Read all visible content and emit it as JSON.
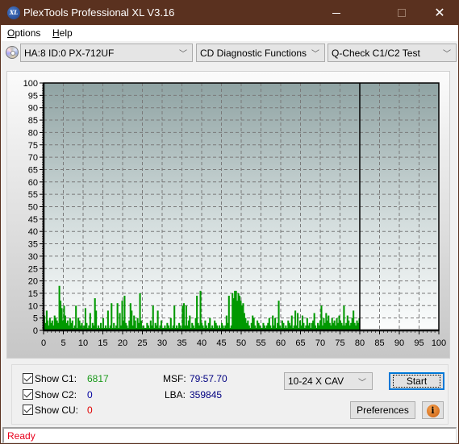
{
  "window": {
    "title": "PlexTools Professional XL V3.16",
    "icon_text": "XL"
  },
  "menu": {
    "items": [
      {
        "label": "Options",
        "mnemonic": "O"
      },
      {
        "label": "Help",
        "mnemonic": "H"
      }
    ]
  },
  "toolbar": {
    "drive": "HA:8 ID:0  PX-712UF",
    "function": "CD Diagnostic Functions",
    "test": "Q-Check C1/C2 Test"
  },
  "chart_data": {
    "type": "bar",
    "title": "",
    "xlabel": "",
    "ylabel": "",
    "xlim": [
      0,
      100
    ],
    "ylim": [
      0,
      100
    ],
    "x_ticks": [
      0,
      5,
      10,
      15,
      20,
      25,
      30,
      35,
      40,
      45,
      50,
      55,
      60,
      65,
      70,
      75,
      80,
      85,
      90,
      95,
      100
    ],
    "y_ticks": [
      0,
      5,
      10,
      15,
      20,
      25,
      30,
      35,
      40,
      45,
      50,
      55,
      60,
      65,
      70,
      75,
      80,
      85,
      90,
      95,
      100
    ],
    "grid": true,
    "end_marker_x": 80,
    "series": [
      {
        "name": "C1",
        "color": "#009900",
        "x": [
          0.2,
          0.5,
          0.8,
          1.0,
          1.3,
          1.6,
          1.9,
          2.2,
          2.5,
          2.8,
          3.1,
          3.4,
          3.7,
          4.0,
          4.3,
          4.6,
          4.9,
          5.2,
          5.5,
          5.8,
          6.1,
          6.4,
          6.7,
          7.0,
          7.3,
          7.6,
          7.9,
          8.2,
          8.5,
          8.8,
          9.1,
          9.4,
          9.7,
          10.0,
          10.3,
          10.6,
          10.9,
          11.2,
          11.5,
          11.8,
          12.1,
          12.4,
          12.7,
          13.0,
          13.3,
          13.6,
          13.9,
          14.2,
          14.5,
          14.8,
          15.1,
          15.4,
          15.7,
          16.0,
          16.3,
          16.6,
          16.9,
          17.2,
          17.5,
          17.8,
          18.1,
          18.4,
          18.7,
          19.0,
          19.3,
          19.6,
          19.9,
          20.2,
          20.5,
          20.8,
          21.1,
          21.4,
          21.7,
          22.0,
          22.3,
          22.6,
          22.9,
          23.2,
          23.5,
          23.8,
          24.1,
          24.4,
          24.7,
          25.0,
          25.3,
          25.6,
          25.9,
          26.2,
          26.5,
          26.8,
          27.1,
          27.4,
          27.7,
          28.0,
          28.3,
          28.6,
          28.9,
          29.2,
          29.5,
          29.8,
          30.1,
          30.4,
          30.7,
          31.0,
          31.3,
          31.6,
          31.9,
          32.2,
          32.5,
          32.8,
          33.1,
          33.4,
          33.7,
          34.0,
          34.3,
          34.6,
          34.9,
          35.2,
          35.5,
          35.8,
          36.1,
          36.4,
          36.7,
          37.0,
          37.3,
          37.6,
          37.9,
          38.2,
          38.5,
          38.8,
          39.1,
          39.4,
          39.7,
          40.0,
          40.3,
          40.6,
          40.9,
          41.2,
          41.5,
          41.8,
          42.1,
          42.4,
          42.7,
          43.0,
          43.3,
          43.6,
          43.9,
          44.2,
          44.5,
          44.8,
          45.1,
          45.4,
          45.7,
          46.0,
          46.3,
          46.6,
          46.9,
          47.2,
          47.5,
          47.8,
          48.1,
          48.4,
          48.7,
          49.0,
          49.3,
          49.6,
          49.9,
          50.2,
          50.5,
          50.8,
          51.1,
          51.4,
          51.7,
          52.0,
          52.3,
          52.6,
          52.9,
          53.2,
          53.5,
          53.8,
          54.1,
          54.4,
          54.7,
          55.0,
          55.3,
          55.6,
          55.9,
          56.2,
          56.5,
          56.8,
          57.1,
          57.4,
          57.7,
          58.0,
          58.3,
          58.6,
          58.9,
          59.2,
          59.5,
          59.8,
          60.1,
          60.4,
          60.7,
          61.0,
          61.3,
          61.6,
          61.9,
          62.2,
          62.5,
          62.8,
          63.1,
          63.4,
          63.7,
          64.0,
          64.3,
          64.6,
          64.9,
          65.2,
          65.5,
          65.8,
          66.1,
          66.4,
          66.7,
          67.0,
          67.3,
          67.6,
          67.9,
          68.2,
          68.5,
          68.8,
          69.1,
          69.4,
          69.7,
          70.0,
          70.3,
          70.6,
          70.9,
          71.2,
          71.5,
          71.8,
          72.1,
          72.4,
          72.7,
          73.0,
          73.3,
          73.6,
          73.9,
          74.2,
          74.5,
          74.8,
          75.1,
          75.4,
          75.7,
          76.0,
          76.3,
          76.6,
          76.9,
          77.2,
          77.5,
          77.8,
          78.1,
          78.4,
          78.7,
          79.0,
          79.3,
          79.6,
          79.9
        ],
        "values": [
          6,
          3,
          8,
          4,
          2,
          5,
          3,
          4,
          2,
          6,
          5,
          4,
          3,
          18,
          12,
          9,
          4,
          10,
          6,
          3,
          4,
          2,
          5,
          3,
          4,
          1,
          2,
          10,
          1,
          5,
          4,
          2,
          3,
          1,
          2,
          9,
          3,
          1,
          2,
          7,
          1,
          3,
          2,
          13,
          8,
          1,
          2,
          1,
          3,
          1,
          5,
          1,
          2,
          1,
          8,
          1,
          2,
          11,
          1,
          3,
          1,
          2,
          11,
          1,
          7,
          2,
          12,
          4,
          14,
          3,
          2,
          1,
          4,
          11,
          8,
          2,
          6,
          4,
          1,
          5,
          3,
          15,
          4,
          1,
          2,
          1,
          1,
          3,
          2,
          1,
          4,
          2,
          10,
          1,
          3,
          2,
          8,
          1,
          2,
          4,
          1,
          1,
          2,
          1,
          3,
          2,
          1,
          5,
          1,
          2,
          10,
          1,
          2,
          1,
          3,
          2,
          1,
          10,
          11,
          2,
          10,
          2,
          4,
          6,
          1,
          3,
          2,
          1,
          5,
          14,
          3,
          2,
          16,
          3,
          2,
          1,
          4,
          2,
          1,
          3,
          5,
          1,
          2,
          1,
          4,
          3,
          2,
          1,
          2,
          1,
          3,
          2,
          1,
          2,
          6,
          3,
          14,
          1,
          2,
          15,
          13,
          16,
          16,
          12,
          15,
          14,
          12,
          10,
          11,
          7,
          5,
          3,
          4,
          2,
          1,
          3,
          6,
          5,
          2,
          1,
          4,
          3,
          2,
          1,
          1,
          3,
          2,
          1,
          2,
          3,
          5,
          2,
          1,
          6,
          2,
          5,
          1,
          3,
          12,
          2,
          1,
          4,
          3,
          1,
          2,
          1,
          4,
          3,
          2,
          6,
          1,
          2,
          8,
          2,
          7,
          1,
          4,
          2,
          6,
          3,
          1,
          2,
          5,
          2,
          3,
          1,
          3,
          4,
          7,
          2,
          1,
          3,
          2,
          4,
          10,
          2,
          5,
          3,
          7,
          4,
          6,
          3,
          2,
          5,
          3,
          4,
          2,
          5,
          3,
          6,
          4,
          3,
          2,
          10,
          2,
          3,
          6,
          4,
          2,
          3,
          5,
          8,
          3,
          2,
          4,
          3,
          5,
          6,
          4,
          3,
          5,
          7,
          9,
          6,
          16,
          8,
          5,
          6,
          7,
          5
        ],
        "total": 6817
      },
      {
        "name": "C2",
        "color": "#0000cc",
        "total": 0
      },
      {
        "name": "CU",
        "color": "#e00000",
        "total": 0
      }
    ]
  },
  "controls": {
    "show_c1_label": "Show C1:",
    "show_c2_label": "Show C2:",
    "show_cu_label": "Show CU:",
    "show_c1_checked": true,
    "show_c2_checked": true,
    "show_cu_checked": true,
    "c1_value": "6817",
    "c2_value": "0",
    "cu_value": "0",
    "msf_label": "MSF:",
    "msf_value": "79:57.70",
    "lba_label": "LBA:",
    "lba_value": "359845",
    "speed": "10-24 X CAV",
    "start_label": "Start",
    "preferences_label": "Preferences"
  },
  "colors": {
    "c1": "#1a9a1a",
    "c2": "#0000a0",
    "cu": "#e00000",
    "msf_lba": "#000080",
    "status": "#e8001c"
  },
  "status": {
    "text": "Ready"
  }
}
